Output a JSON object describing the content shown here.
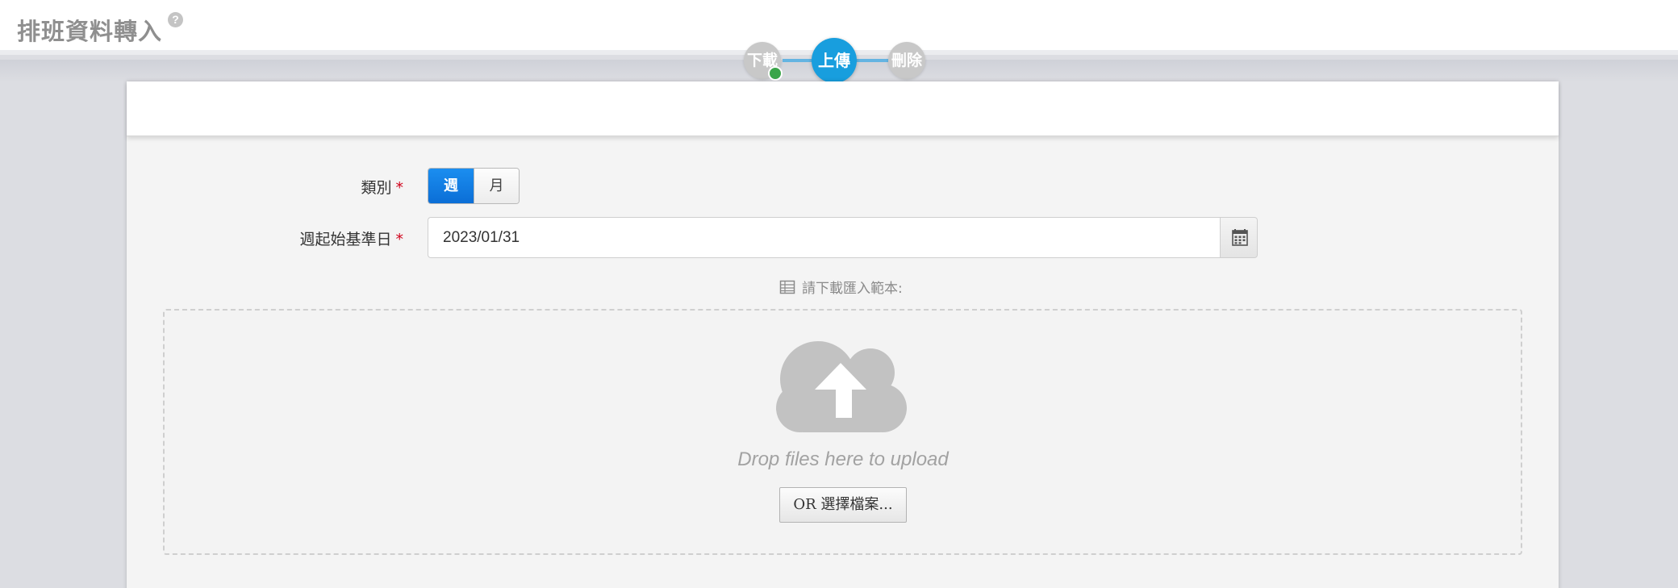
{
  "header": {
    "title": "排班資料轉入",
    "help_glyph": "?"
  },
  "steps": [
    {
      "label": "下載",
      "state": "done"
    },
    {
      "label": "上傳",
      "state": "active"
    },
    {
      "label": "刪除",
      "state": "pending"
    }
  ],
  "colors": {
    "step_active": "#189ede",
    "step_inactive": "#c8c8c8",
    "step_done_dot": "#3aa549",
    "toggle_selected": "#0b6ed6",
    "required_mark": "#d0021b"
  },
  "form": {
    "category": {
      "label": "類別",
      "required_mark": "*",
      "options": [
        "週",
        "月"
      ],
      "selected": "週"
    },
    "start_date": {
      "label": "週起始基準日",
      "required_mark": "*",
      "value": "2023/01/31",
      "button_icon": "calendar-icon"
    },
    "template_hint": {
      "icon": "spreadsheet-icon",
      "text": "請下載匯入範本:"
    }
  },
  "upload": {
    "icon": "cloud-upload-icon",
    "drop_text": "Drop files here to upload",
    "browse_label": "OR 選擇檔案..."
  }
}
